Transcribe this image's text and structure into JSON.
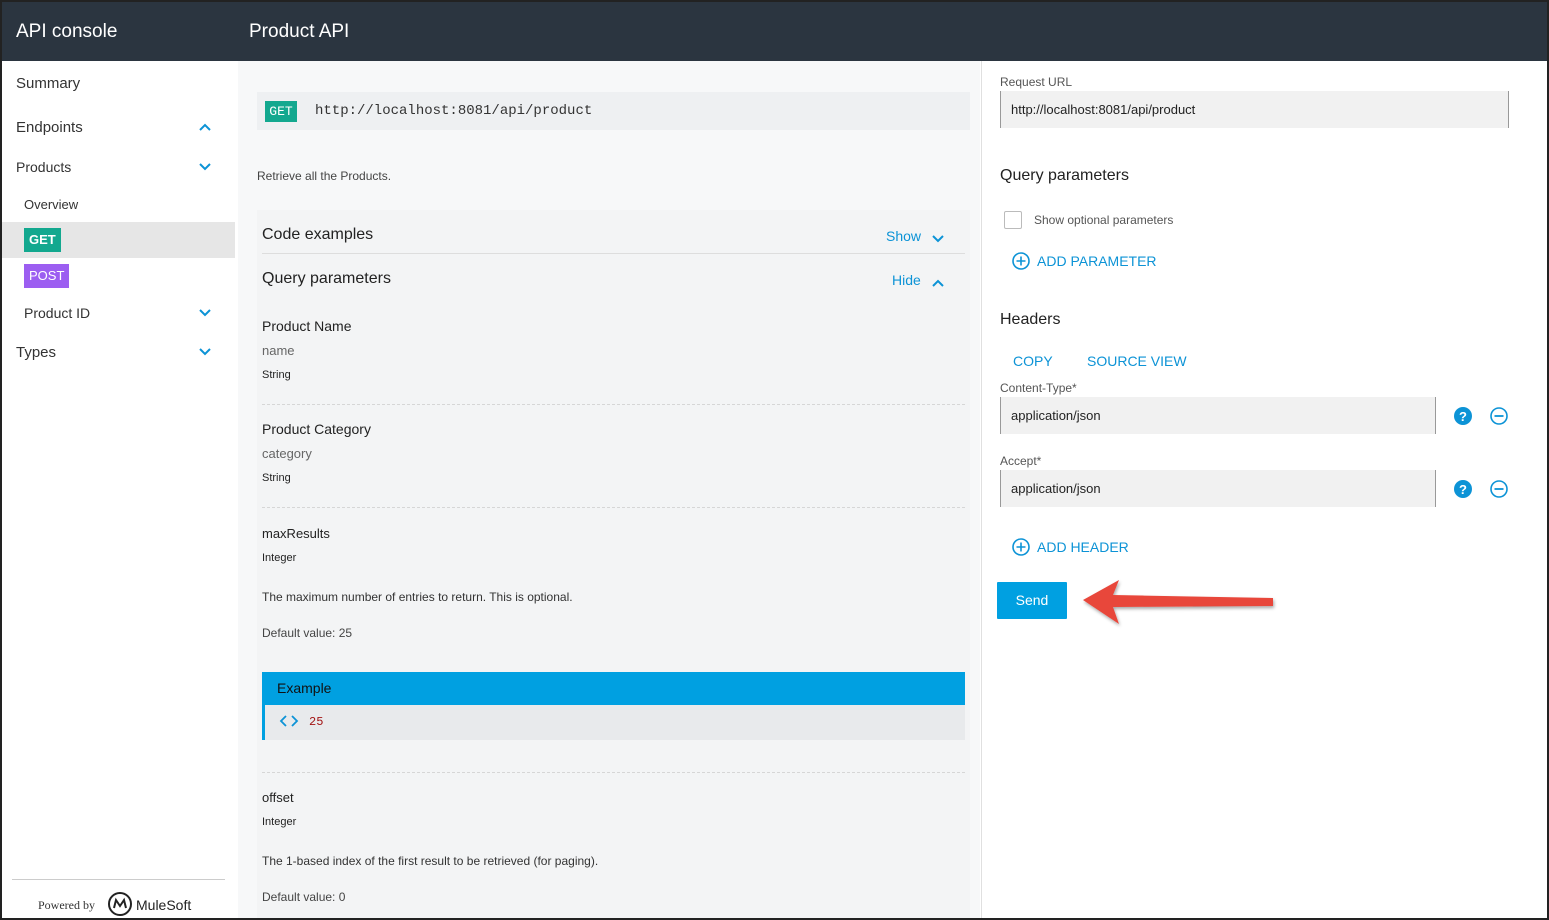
{
  "header": {
    "app_title": "API console",
    "api_title": "Product API"
  },
  "sidebar": {
    "items": [
      {
        "label": "Summary"
      },
      {
        "label": "Endpoints"
      },
      {
        "label": "Products"
      },
      {
        "label": "Overview"
      },
      {
        "label": "GET"
      },
      {
        "label": "POST"
      },
      {
        "label": "Product ID"
      },
      {
        "label": "Types"
      }
    ],
    "powered_by": "Powered by",
    "brand": "MuleSoft"
  },
  "main": {
    "method": "GET",
    "url": "http://localhost:8081/api/product",
    "description": "Retrieve all the Products.",
    "code_examples": {
      "title": "Code examples",
      "action": "Show"
    },
    "query_params": {
      "title": "Query parameters",
      "action": "Hide"
    },
    "params": [
      {
        "name": "Product Name",
        "key": "name",
        "type": "String"
      },
      {
        "name": "Product Category",
        "key": "category",
        "type": "String"
      },
      {
        "name": "maxResults",
        "type": "Integer",
        "description": "The maximum number of entries to return. This is optional.",
        "default": "Default value:   25"
      },
      {
        "name": "offset",
        "type": "Integer",
        "description": "The 1-based index of the first result to be retrieved (for paging).",
        "default": "Default value:   0"
      }
    ],
    "example": {
      "title": "Example",
      "value": "25"
    }
  },
  "request": {
    "url_label": "Request URL",
    "url_value": "http://localhost:8081/api/product",
    "query_title": "Query parameters",
    "show_optional": "Show optional parameters",
    "add_parameter": "ADD PARAMETER",
    "headers_title": "Headers",
    "copy": "COPY",
    "source_view": "SOURCE VIEW",
    "headers": [
      {
        "label": "Content-Type*",
        "value": "application/json"
      },
      {
        "label": "Accept*",
        "value": "application/json"
      }
    ],
    "add_header": "ADD HEADER",
    "send": "Send"
  },
  "colors": {
    "accent": "#00a0e1",
    "get": "#13a88f",
    "post": "#9c5ef1",
    "topbar": "#2b3540",
    "arrow": "#e8463a"
  }
}
